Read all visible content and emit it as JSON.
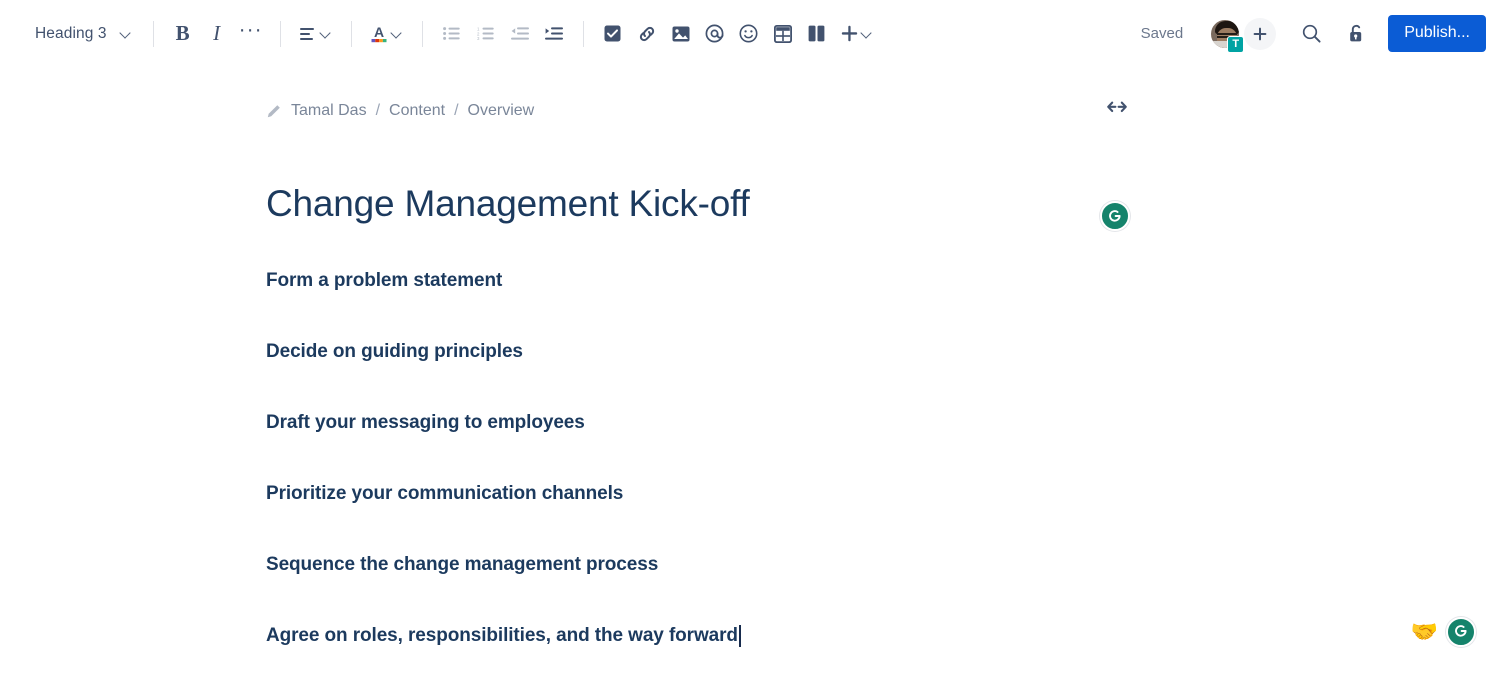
{
  "toolbar": {
    "style_select": {
      "label": "Heading 3",
      "icon": "chevron-down-icon"
    },
    "bold_label": "B",
    "italic_label": "I",
    "more_formatting_label": "···",
    "buttons": [
      {
        "name": "bold",
        "label": "B"
      },
      {
        "name": "italic",
        "label": "I"
      },
      {
        "name": "more-formatting",
        "label": "•••"
      },
      {
        "name": "text-align",
        "label": "Text alignment"
      },
      {
        "name": "text-color",
        "label": "Text color"
      },
      {
        "name": "bullet-list",
        "label": "Bulleted list"
      },
      {
        "name": "numbered-list",
        "label": "Numbered list"
      },
      {
        "name": "outdent",
        "label": "Outdent"
      },
      {
        "name": "indent",
        "label": "Indent"
      },
      {
        "name": "action-item",
        "label": "Action item"
      },
      {
        "name": "link",
        "label": "Link"
      },
      {
        "name": "image",
        "label": "Image"
      },
      {
        "name": "mention",
        "label": "Mention"
      },
      {
        "name": "emoji",
        "label": "Emoji"
      },
      {
        "name": "table",
        "label": "Table"
      },
      {
        "name": "layout",
        "label": "Page layout"
      },
      {
        "name": "insert-more",
        "label": "Insert more content"
      }
    ],
    "status_text": "Saved",
    "avatar_initial": "T",
    "add_people_label": "+",
    "search_label": "Search",
    "restrictions_label": "Restrictions",
    "publish_label": "Publish...",
    "publish_color": "#0b5cd5"
  },
  "breadcrumb": {
    "pencil_icon": "pencil-icon",
    "items": [
      "Tamal Das",
      "Content",
      "Overview"
    ],
    "separator": "/",
    "expand_icon": "expand-width-icon"
  },
  "document": {
    "title": "Change Management Kick-off",
    "title_color": "#1c3a5e",
    "lines": [
      "Form a problem statement",
      "Decide on guiding principles",
      "Draft your messaging to employees",
      "Prioritize your communication channels",
      "Sequence the change management process",
      "Agree on roles, responsibilities, and the way forward"
    ],
    "cursor_line_index": 5,
    "grammarly_badge_label": "G",
    "grammarly_color": "#15836b",
    "handshake_emoji": "🤝"
  }
}
